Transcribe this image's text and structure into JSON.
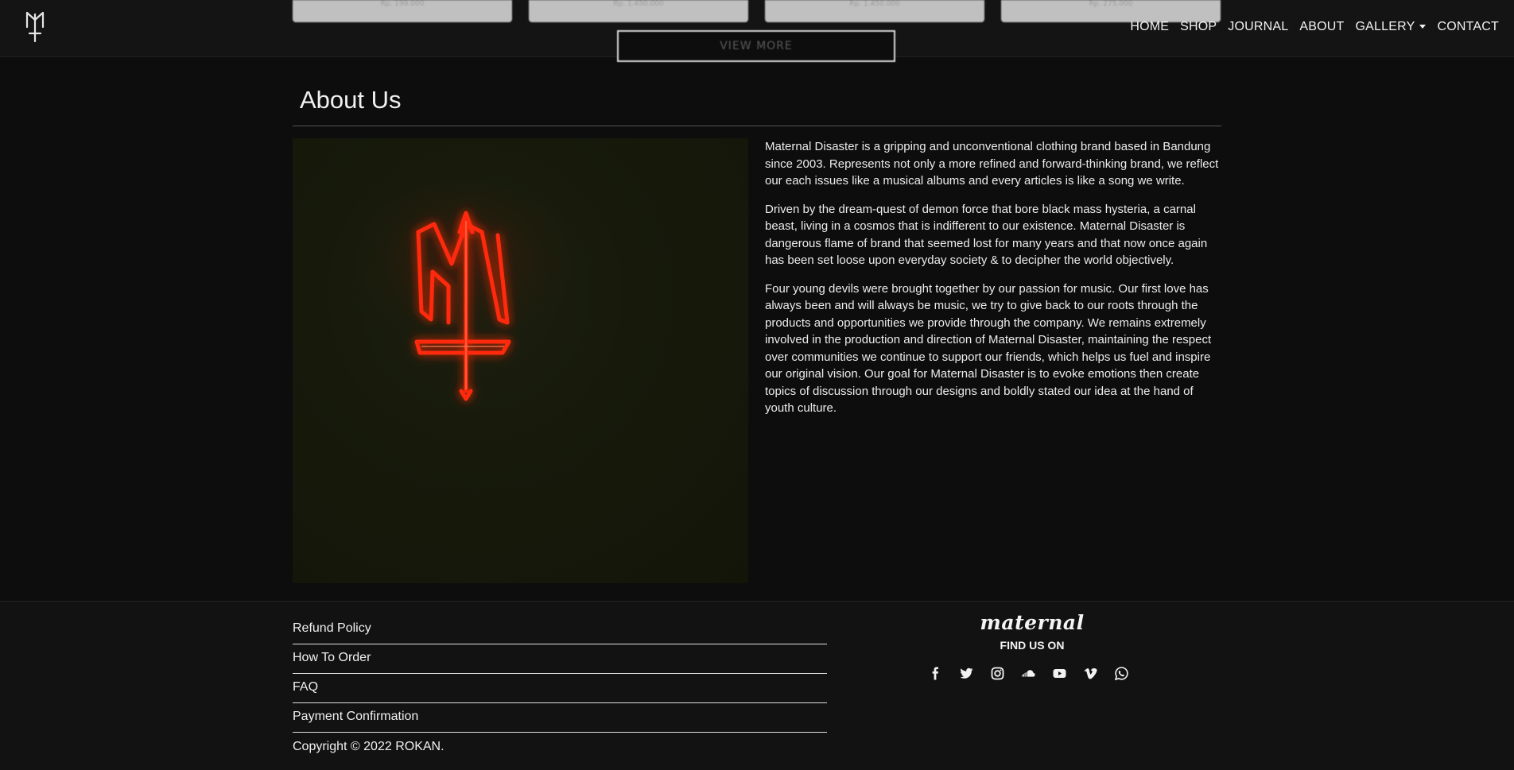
{
  "header": {
    "logo_alt": "Maternal Disaster trident logo",
    "product_prices": [
      "Rp. 199.000",
      "Rp. 1.450.000",
      "Rp. 1.450.000",
      "Rp. 275.000"
    ],
    "view_more_label": "VIEW MORE",
    "nav": [
      {
        "label": "HOME"
      },
      {
        "label": "SHOP"
      },
      {
        "label": "JOURNAL"
      },
      {
        "label": "ABOUT"
      },
      {
        "label": "GALLERY",
        "has_dropdown": true
      },
      {
        "label": "CONTACT"
      }
    ]
  },
  "about": {
    "title": "About Us",
    "paragraphs": [
      "Maternal Disaster is a gripping and unconventional clothing brand based in Bandung since 2003. Represents not only a more refined and forward-thinking brand, we reflect our each issues like a musical albums and every articles is like a song we write.",
      "Driven by the dream-quest of demon force that bore black mass hysteria, a carnal beast, living in a cosmos that is indifferent to our existence. Maternal Disaster is dangerous flame of brand that seemed lost for many years and that now once again has been set loose upon everyday society & to decipher the world objectively.",
      "Four young devils were brought together by our passion for music. Our first love has always been and will always be music, we try to give back to our roots through the products and opportunities we provide through the company. We remains extremely involved in the production and direction of Maternal Disaster, maintaining the respect over communities we continue to support our friends, which helps us fuel and inspire our original vision. Our goal for Maternal Disaster is to evoke emotions then create topics of discussion through our designs and boldly stated our idea at the hand of youth culture."
    ],
    "image_colors": {
      "neon": "#ff2a10",
      "background": "#171a0b"
    }
  },
  "footer": {
    "links": [
      "Refund Policy",
      "How To Order",
      "FAQ",
      "Payment Confirmation"
    ],
    "copyright": "Copyright © 2022 ROKAN.",
    "wordmark": "maternal",
    "find_us_label": "FIND US ON",
    "social_icons": [
      "facebook-icon",
      "twitter-icon",
      "instagram-icon",
      "soundcloud-icon",
      "youtube-icon",
      "vimeo-icon",
      "whatsapp-icon"
    ]
  },
  "colors": {
    "background": "#0d0d0d",
    "text": "#e8e8e8",
    "accent_neon": "#ff2a10"
  }
}
